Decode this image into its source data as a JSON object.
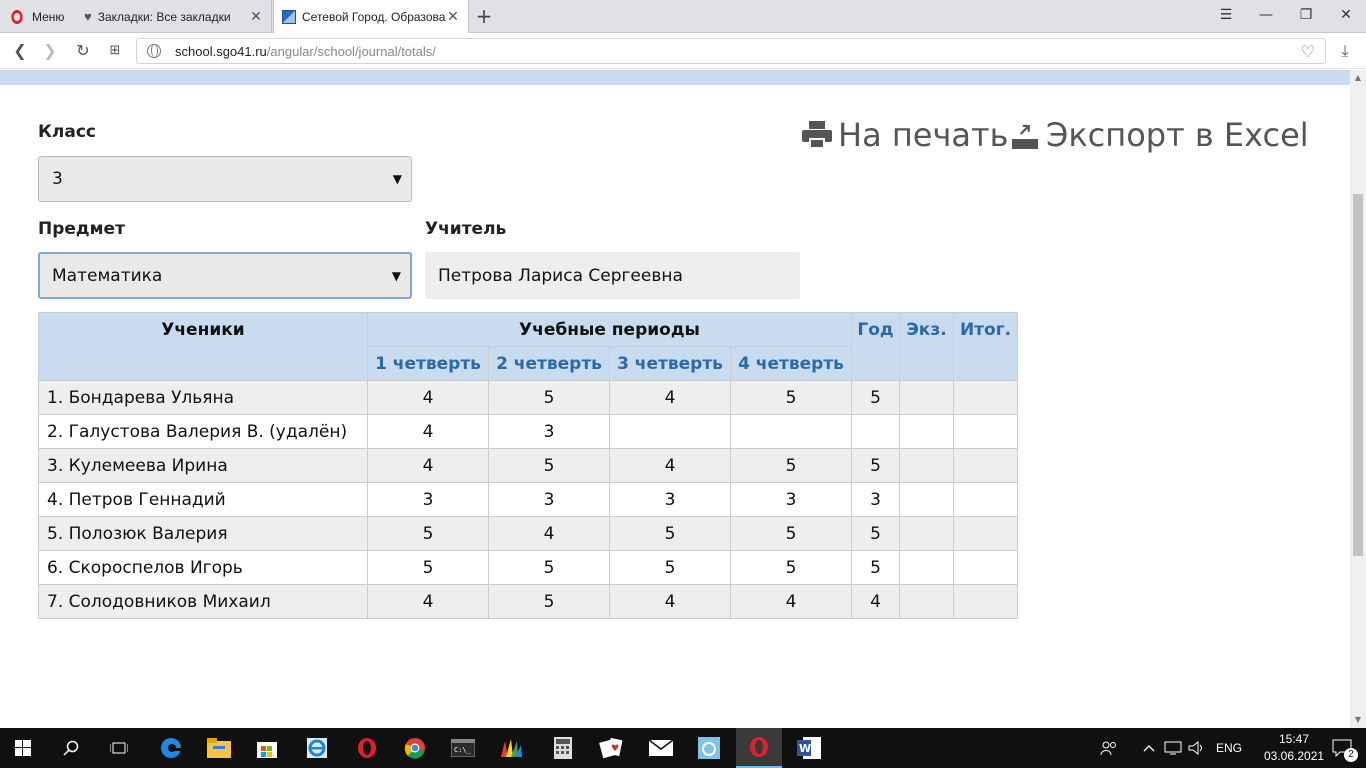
{
  "browser": {
    "menu_label": "Меню",
    "tabs": [
      {
        "title": "Закладки: Все закладки"
      },
      {
        "title": "Сетевой Город. Образова"
      }
    ],
    "new_tab": "+",
    "url_host": "school.sgo41.ru",
    "url_path": "/angular/school/journal/totals/"
  },
  "filters": {
    "class_label": "Класс",
    "class_value": "3",
    "subject_label": "Предмет",
    "subject_value": "Математика",
    "teacher_label": "Учитель",
    "teacher_value": "Петрова Лариса Сергеевна"
  },
  "actions": {
    "print": "На печать",
    "export": "Экспорт в Excel"
  },
  "table": {
    "header_students": "Ученики",
    "header_periods": "Учебные периоды",
    "header_year": "Год",
    "header_exam": "Экз.",
    "header_total": "Итог.",
    "quarters": [
      "1 четверть",
      "2 четверть",
      "3 четверть",
      "4 четверть"
    ],
    "rows": [
      {
        "name": "1. Бондарева Ульяна",
        "q1": "4",
        "q2": "5",
        "q3": "4",
        "q4": "5",
        "year": "5",
        "exam": "",
        "total": ""
      },
      {
        "name": "2. Галустова Валерия В. (удалён)",
        "q1": "4",
        "q2": "3",
        "q3": "",
        "q4": "",
        "year": "",
        "exam": "",
        "total": ""
      },
      {
        "name": "3. Кулемеева Ирина",
        "q1": "4",
        "q2": "5",
        "q3": "4",
        "q4": "5",
        "year": "5",
        "exam": "",
        "total": ""
      },
      {
        "name": "4. Петров Геннадий",
        "q1": "3",
        "q2": "3",
        "q3": "3",
        "q4": "3",
        "year": "3",
        "exam": "",
        "total": ""
      },
      {
        "name": "5. Полозюк Валерия",
        "q1": "5",
        "q2": "4",
        "q3": "5",
        "q4": "5",
        "year": "5",
        "exam": "",
        "total": ""
      },
      {
        "name": "6. Скороспелов Игорь",
        "q1": "5",
        "q2": "5",
        "q3": "5",
        "q4": "5",
        "year": "5",
        "exam": "",
        "total": ""
      },
      {
        "name": "7. Солодовников Михаил",
        "q1": "4",
        "q2": "5",
        "q3": "4",
        "q4": "4",
        "year": "4",
        "exam": "",
        "total": ""
      }
    ]
  },
  "taskbar": {
    "lang": "ENG",
    "time": "15:47",
    "date": "03.06.2021",
    "notifications": "2"
  },
  "colors": {
    "header_bg": "#c9dbef",
    "header_blue_text": "#2a6aa8",
    "row_alt": "#eeeeee",
    "opera_red": "#e0202d"
  }
}
